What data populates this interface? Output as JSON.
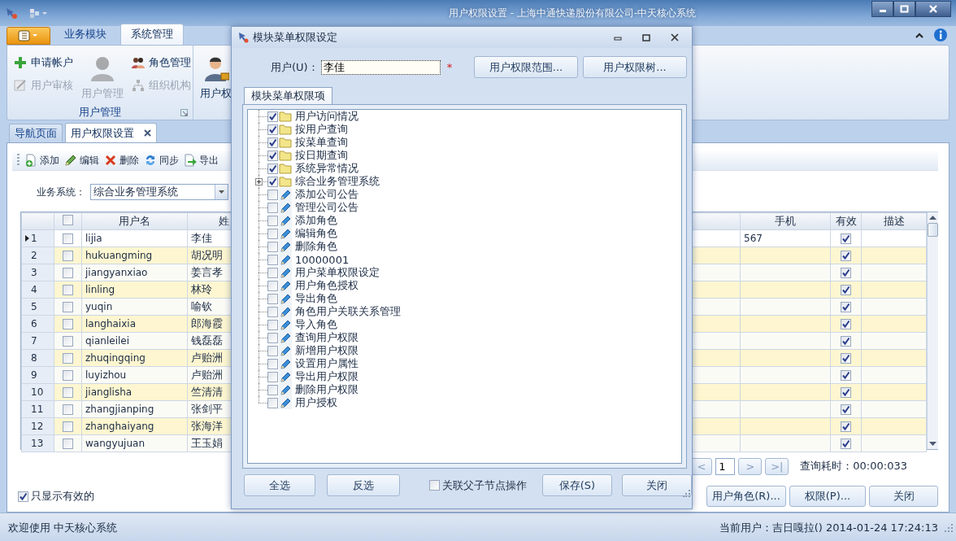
{
  "window": {
    "title": "用户权限设置 - 上海中通快递股份有限公司-中天核心系统"
  },
  "ribbon": {
    "tabs": [
      {
        "label": "业务模块",
        "selected": false
      },
      {
        "label": "系统管理",
        "selected": true
      }
    ],
    "groups": [
      {
        "title": "用户管理",
        "columns": [
          [
            {
              "label": "申请帐户",
              "kind": "add",
              "disabled": false
            },
            {
              "label": "用户审核",
              "kind": "review",
              "disabled": true
            }
          ],
          [
            {
              "label": "用户管理",
              "kind": "user",
              "disabled": true
            }
          ],
          [
            {
              "label": "角色管理",
              "kind": "role",
              "disabled": false
            },
            {
              "label": "组织机构",
              "kind": "org",
              "disabled": true
            }
          ]
        ]
      },
      {
        "columns": [
          [
            {
              "label": "用户权",
              "kind": "permission",
              "disabled": false
            }
          ]
        ]
      }
    ]
  },
  "doc_tabs": [
    {
      "label": "导航页面",
      "selected": false,
      "closable": false
    },
    {
      "label": "用户权限设置",
      "selected": true,
      "closable": true
    }
  ],
  "toolbar": [
    {
      "label": "添加",
      "kind": "add"
    },
    {
      "label": "编辑",
      "kind": "edit"
    },
    {
      "label": "删除",
      "kind": "delete"
    },
    {
      "label": "同步",
      "kind": "sync"
    },
    {
      "label": "导出",
      "kind": "export"
    }
  ],
  "filter": {
    "label": "业务系统：",
    "value": "综合业务管理系统"
  },
  "grid": {
    "header_checked": false,
    "columns": [
      "用户名",
      "姓",
      "手机",
      "有效",
      "描述"
    ],
    "rows": [
      {
        "num": "1",
        "selected": true,
        "checked": false,
        "username": "lijia",
        "name": "李佳",
        "phone": "567",
        "valid": true
      },
      {
        "num": "2",
        "selected": false,
        "checked": false,
        "username": "hukuangming",
        "name": "胡况明",
        "valid": true
      },
      {
        "num": "3",
        "selected": false,
        "checked": false,
        "username": "jiangyanxiao",
        "name": "姜言孝",
        "valid": true
      },
      {
        "num": "4",
        "selected": false,
        "checked": false,
        "username": "linling",
        "name": "林玲",
        "valid": true
      },
      {
        "num": "5",
        "selected": false,
        "checked": false,
        "username": "yuqin",
        "name": "喻钦",
        "valid": true
      },
      {
        "num": "6",
        "selected": false,
        "checked": false,
        "username": "langhaixia",
        "name": "郎海霞",
        "valid": true
      },
      {
        "num": "7",
        "selected": false,
        "checked": false,
        "username": "qianleilei",
        "name": "钱磊磊",
        "valid": true
      },
      {
        "num": "8",
        "selected": false,
        "checked": false,
        "username": "zhuqingqing",
        "name": "卢贻洲",
        "valid": true
      },
      {
        "num": "9",
        "selected": false,
        "checked": false,
        "username": "luyizhou",
        "name": "卢贻洲",
        "valid": true
      },
      {
        "num": "10",
        "selected": false,
        "checked": false,
        "username": "jianglisha",
        "name": "竺清清",
        "valid": true
      },
      {
        "num": "11",
        "selected": false,
        "checked": false,
        "username": "zhangjianping",
        "name": "张剑平",
        "valid": true
      },
      {
        "num": "12",
        "selected": false,
        "checked": false,
        "username": "zhanghaiyang",
        "name": "张海洋",
        "valid": true
      },
      {
        "num": "13",
        "selected": false,
        "checked": false,
        "username": "wangyujuan",
        "name": "王玉娟",
        "valid": true
      }
    ]
  },
  "pager": {
    "prev": "<",
    "page": "1",
    "next": ">",
    "last": ">|",
    "elapsed": "查询耗时：00:00:033"
  },
  "only_valid": {
    "label": "只显示有效的",
    "checked": true
  },
  "bottom_buttons": [
    "用户角色(R)...",
    "权限(P)...",
    "关闭"
  ],
  "status_bar": {
    "left": "欢迎使用 中天核心系统",
    "right": "当前用户：吉日嘎拉() 2014-01-24 17:24:13"
  },
  "dialog": {
    "title": "模块菜单权限设定",
    "user_label": "用户(U)：",
    "user_value": "李佳",
    "required_mark": "*",
    "top_buttons": [
      "用户权限范围...",
      "用户权限树..."
    ],
    "tabs": [
      {
        "label": "模块菜单权限项",
        "selected": true
      }
    ],
    "tree": [
      {
        "label": "用户访问情况",
        "kind": "folder",
        "checked": true
      },
      {
        "label": "按用户查询",
        "kind": "folder",
        "checked": true
      },
      {
        "label": "按菜单查询",
        "kind": "folder",
        "checked": true
      },
      {
        "label": "按日期查询",
        "kind": "folder",
        "checked": true
      },
      {
        "label": "系统异常情况",
        "kind": "folder",
        "checked": true
      },
      {
        "label": "综合业务管理系统",
        "kind": "folder",
        "checked": true,
        "expanded": false
      },
      {
        "label": "添加公司公告",
        "kind": "item",
        "checked": false
      },
      {
        "label": "管理公司公告",
        "kind": "item",
        "checked": false
      },
      {
        "label": "添加角色",
        "kind": "item",
        "checked": false
      },
      {
        "label": "编辑角色",
        "kind": "item",
        "checked": false
      },
      {
        "label": "删除角色",
        "kind": "item",
        "checked": false
      },
      {
        "label": "10000001",
        "kind": "item",
        "checked": false
      },
      {
        "label": "用户菜单权限设定",
        "kind": "item",
        "checked": false
      },
      {
        "label": "用户角色授权",
        "kind": "item",
        "checked": false
      },
      {
        "label": "导出角色",
        "kind": "item",
        "checked": false
      },
      {
        "label": "角色用户关联关系管理",
        "kind": "item",
        "checked": false
      },
      {
        "label": "导入角色",
        "kind": "item",
        "checked": false
      },
      {
        "label": "查询用户权限",
        "kind": "item",
        "checked": false
      },
      {
        "label": "新增用户权限",
        "kind": "item",
        "checked": false
      },
      {
        "label": "设置用户属性",
        "kind": "item",
        "checked": false
      },
      {
        "label": "导出用户权限",
        "kind": "item",
        "checked": false
      },
      {
        "label": "删除用户权限",
        "kind": "item",
        "checked": false
      },
      {
        "label": "用户授权",
        "kind": "item",
        "checked": false
      }
    ],
    "buttons_left": [
      "全选",
      "反选"
    ],
    "link_checkbox": {
      "label": "关联父子节点操作",
      "checked": false
    },
    "buttons_right": [
      "保存(S)",
      "关闭"
    ]
  }
}
